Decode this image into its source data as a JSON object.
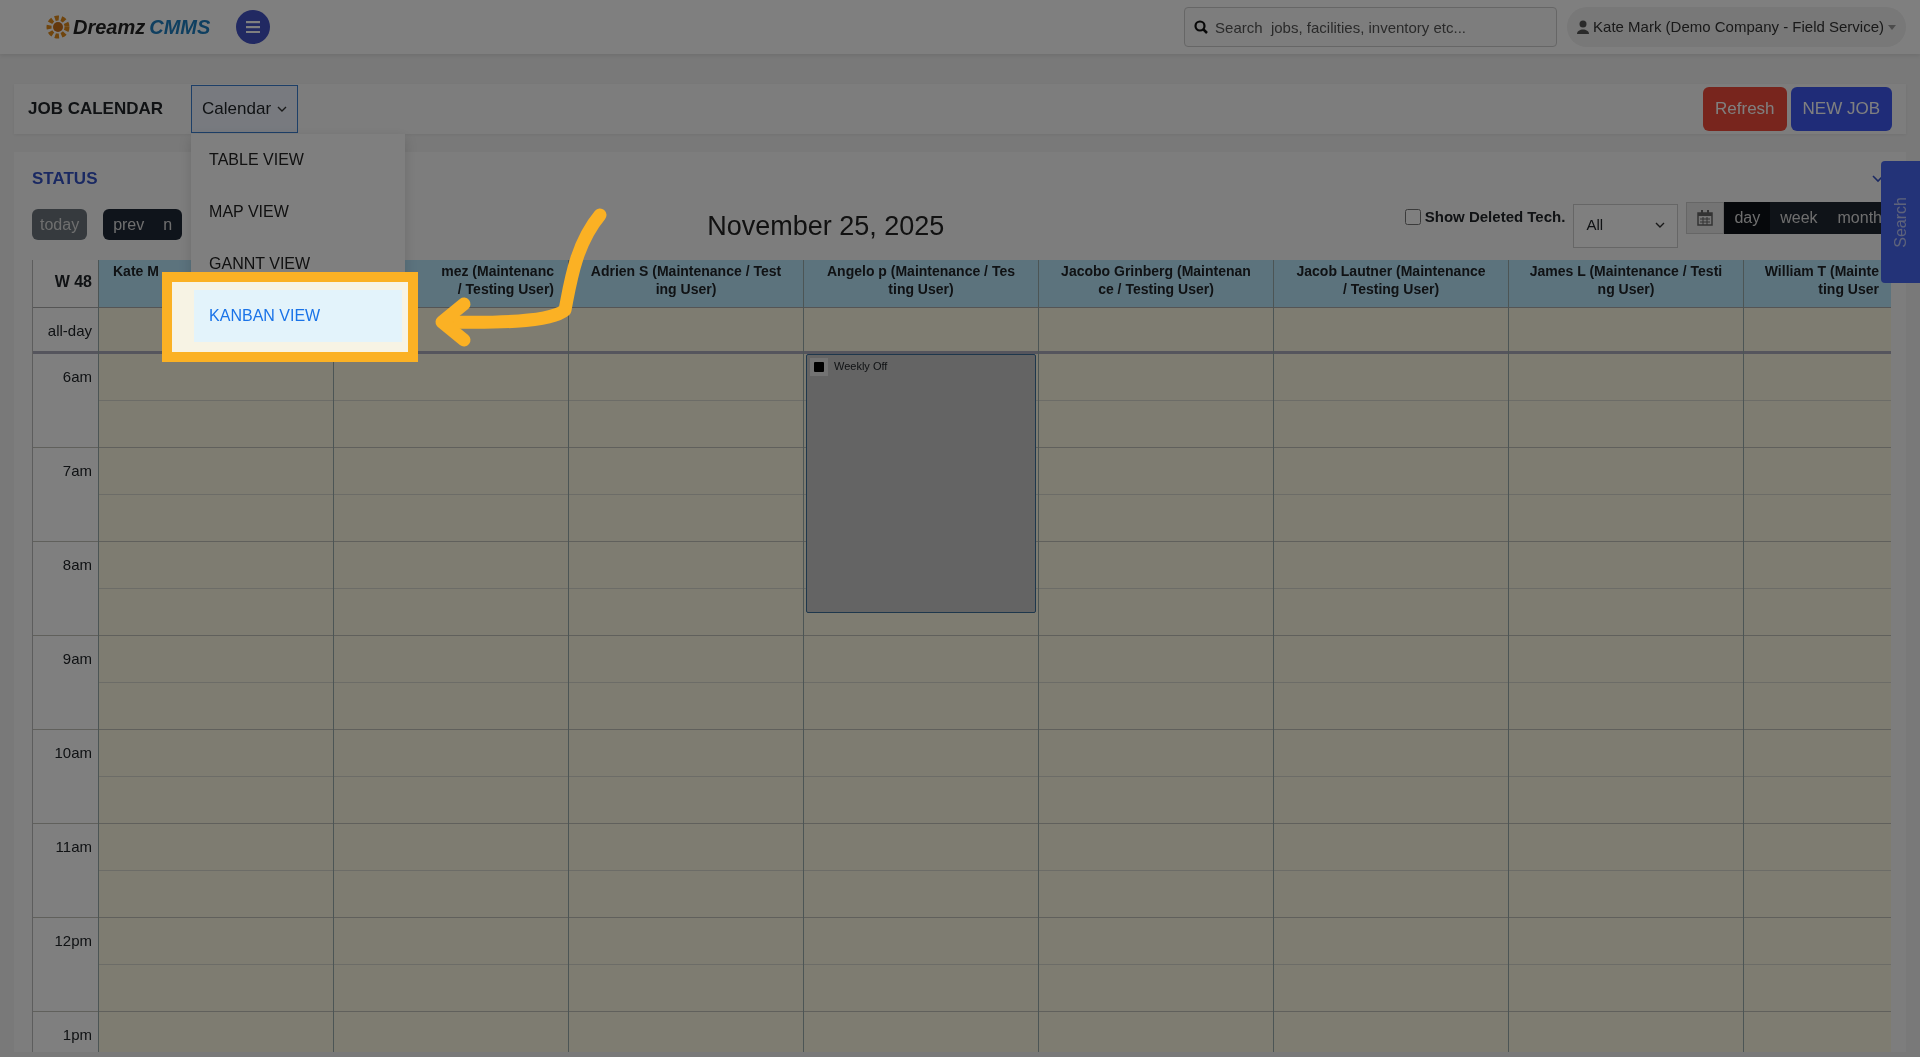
{
  "brand": {
    "name": "Dreamz",
    "suffix": "CMMS"
  },
  "search": {
    "placeholder": "Search  jobs, facilities, inventory etc..."
  },
  "user": {
    "name": "Kate Mark (Demo Company - Field Service)"
  },
  "toolbar": {
    "title": "JOB CALENDAR",
    "view_toggle": "Calendar",
    "buttons": [
      "Refresh",
      "NEW JOB"
    ]
  },
  "view_menu": [
    {
      "label": "TABLE VIEW",
      "selected": false
    },
    {
      "label": "MAP VIEW",
      "selected": false
    },
    {
      "label": "GANNT VIEW",
      "selected": false
    },
    {
      "label": "KANBAN VIEW",
      "selected": true
    }
  ],
  "status_heading": "STATUS",
  "nav": {
    "today": "today",
    "prev": "prev",
    "next": "n"
  },
  "date_title": "November 25, 2025",
  "show_deleted": {
    "label": "Show Deleted Tech.",
    "checked": false
  },
  "tech_filter": "All",
  "range_buttons": [
    {
      "label": "day",
      "selected": true
    },
    {
      "label": "week",
      "selected": false
    },
    {
      "label": "month",
      "selected": false
    }
  ],
  "side_tab": "Search",
  "calendar": {
    "week": "W 48",
    "allday": "all-day",
    "columns": [
      {
        "lines": [
          "Kate M"
        ]
      },
      {
        "lines": [
          "mez (Maintenanc",
          "/ Testing User)"
        ]
      },
      {
        "lines": [
          "Adrien S (Maintenance / Test",
          "ing User)"
        ]
      },
      {
        "lines": [
          "Angelo p (Maintenance / Tes",
          "ting User)"
        ],
        "events": [
          {
            "title": "Weekly Off"
          }
        ]
      },
      {
        "lines": [
          "Jacobo Grinberg (Maintenan",
          "ce / Testing User)"
        ]
      },
      {
        "lines": [
          "Jacob Lautner (Maintenance",
          "/ Testing User)"
        ]
      },
      {
        "lines": [
          "James L (Maintenance / Testi",
          "ng User)"
        ]
      },
      {
        "lines": [
          "William T (Mainte",
          "ting User"
        ]
      }
    ],
    "hours": [
      "6am",
      "7am",
      "8am",
      "9am",
      "10am",
      "11am",
      "12pm",
      "1pm"
    ]
  }
}
